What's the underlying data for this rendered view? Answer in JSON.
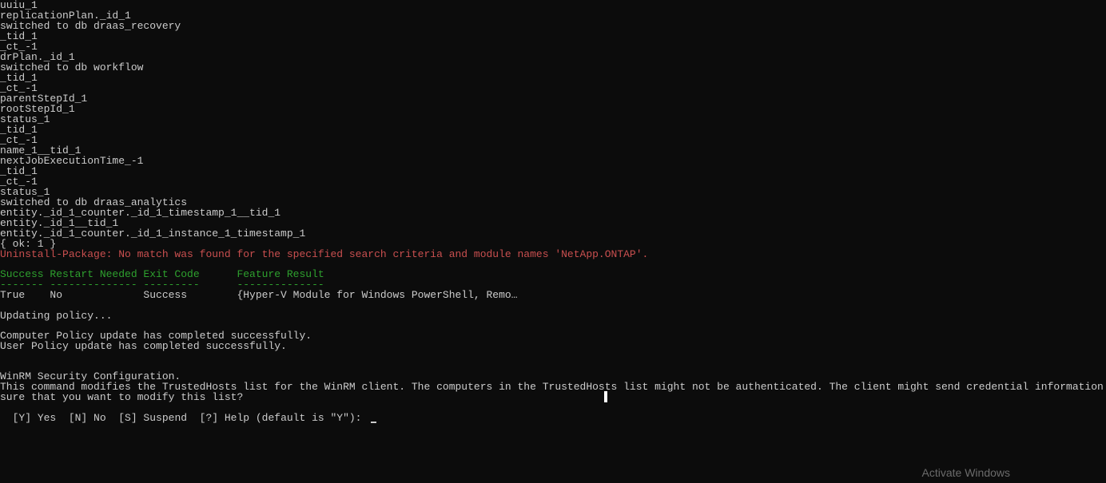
{
  "terminal": {
    "lines": [
      {
        "text": "uuiu_1",
        "color": "default"
      },
      {
        "text": "replicationPlan._id_1",
        "color": "default"
      },
      {
        "text": "switched to db draas_recovery",
        "color": "default"
      },
      {
        "text": "_tid_1",
        "color": "default"
      },
      {
        "text": "_ct_-1",
        "color": "default"
      },
      {
        "text": "drPlan._id_1",
        "color": "default"
      },
      {
        "text": "switched to db workflow",
        "color": "default"
      },
      {
        "text": "_tid_1",
        "color": "default"
      },
      {
        "text": "_ct_-1",
        "color": "default"
      },
      {
        "text": "parentStepId_1",
        "color": "default"
      },
      {
        "text": "rootStepId_1",
        "color": "default"
      },
      {
        "text": "status_1",
        "color": "default"
      },
      {
        "text": "_tid_1",
        "color": "default"
      },
      {
        "text": "_ct_-1",
        "color": "default"
      },
      {
        "text": "name_1__tid_1",
        "color": "default"
      },
      {
        "text": "nextJobExecutionTime_-1",
        "color": "default"
      },
      {
        "text": "_tid_1",
        "color": "default"
      },
      {
        "text": "_ct_-1",
        "color": "default"
      },
      {
        "text": "status_1",
        "color": "default"
      },
      {
        "text": "switched to db draas_analytics",
        "color": "default"
      },
      {
        "text": "entity._id_1_counter._id_1_timestamp_1__tid_1",
        "color": "default"
      },
      {
        "text": "entity._id_1__tid_1",
        "color": "default"
      },
      {
        "text": "entity._id_1_counter._id_1_instance_1_timestamp_1",
        "color": "default"
      },
      {
        "text": "{ ok: 1 }",
        "color": "default"
      },
      {
        "text": "Uninstall-Package: No match was found for the specified search criteria and module names 'NetApp.ONTAP'.",
        "color": "red"
      },
      {
        "text": "",
        "color": "default"
      },
      {
        "text": "Success Restart Needed Exit Code      Feature Result",
        "color": "green"
      },
      {
        "text": "------- -------------- ---------      --------------",
        "color": "green"
      },
      {
        "text": "True    No             Success        {Hyper-V Module for Windows PowerShell, Remo…",
        "color": "default"
      },
      {
        "text": "",
        "color": "default"
      },
      {
        "text": "Updating policy...",
        "color": "default"
      },
      {
        "text": "",
        "color": "default"
      },
      {
        "text": "Computer Policy update has completed successfully.",
        "color": "default"
      },
      {
        "text": "User Policy update has completed successfully.",
        "color": "default"
      },
      {
        "text": "",
        "color": "default"
      },
      {
        "text": "",
        "color": "default"
      },
      {
        "text": "WinRM Security Configuration.",
        "color": "default"
      },
      {
        "text": "This command modifies the TrustedHosts list for the WinRM client. The computers in the TrustedHosts list might not be authenticated. The client might send credential information to these computers. Are you",
        "color": "default"
      },
      {
        "text": "sure that you want to modify this list?",
        "color": "default"
      }
    ],
    "prompt": {
      "text": "[Y] Yes  [N] No  [S] Suspend  [?] Help (default is \"Y\"): ",
      "options": [
        {
          "key": "Y",
          "label": "Yes"
        },
        {
          "key": "N",
          "label": "No"
        },
        {
          "key": "S",
          "label": "Suspend"
        },
        {
          "key": "?",
          "label": "Help"
        }
      ],
      "default": "Y"
    }
  },
  "watermark": {
    "text": "Activate Windows"
  }
}
